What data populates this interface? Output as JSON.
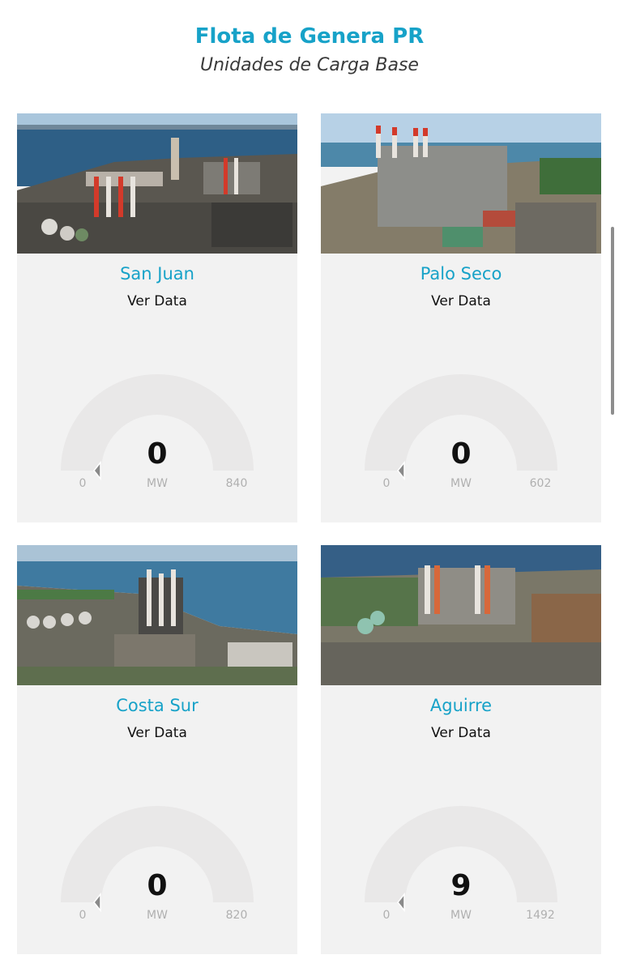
{
  "header": {
    "title": "Flota de Genera PR",
    "subtitle": "Unidades de Carga Base"
  },
  "plants": [
    {
      "name": "San Juan",
      "link": "Ver Data",
      "value": "0",
      "unit": "MW",
      "min": "0",
      "max": "840",
      "fraction": 0.0
    },
    {
      "name": "Palo Seco",
      "link": "Ver Data",
      "value": "0",
      "unit": "MW",
      "min": "0",
      "max": "602",
      "fraction": 0.0
    },
    {
      "name": "Costa Sur",
      "link": "Ver Data",
      "value": "0",
      "unit": "MW",
      "min": "0",
      "max": "820",
      "fraction": 0.0
    },
    {
      "name": "Aguirre",
      "link": "Ver Data",
      "value": "9",
      "unit": "MW",
      "min": "0",
      "max": "1492",
      "fraction": 0.006
    }
  ],
  "colors": {
    "accent": "#17a2c8",
    "card_bg": "#f2f2f2",
    "gauge_track": "#e9e8e8",
    "needle": "#8a8a8a"
  }
}
